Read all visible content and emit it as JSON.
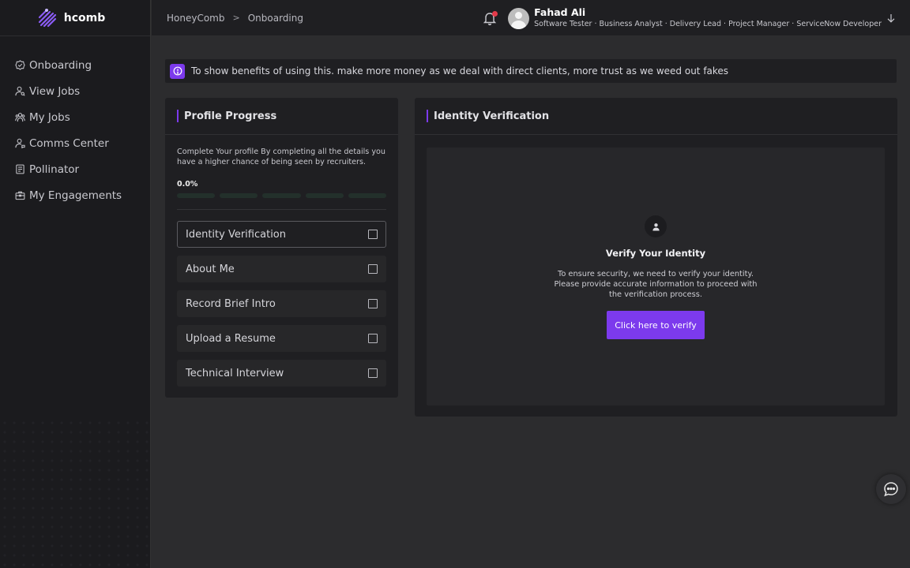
{
  "brand": {
    "name": "hcomb"
  },
  "sidebar": {
    "items": [
      {
        "label": "Onboarding",
        "icon": "badge-check-icon"
      },
      {
        "label": "View Jobs",
        "icon": "user-search-icon"
      },
      {
        "label": "My Jobs",
        "icon": "users-icon"
      },
      {
        "label": "Comms Center",
        "icon": "user-chat-icon"
      },
      {
        "label": "Pollinator",
        "icon": "document-icon"
      },
      {
        "label": "My Engagements",
        "icon": "briefcase-icon"
      }
    ]
  },
  "breadcrumb": {
    "root": "HoneyComb",
    "separator": ">",
    "current": "Onboarding"
  },
  "user": {
    "name": "Fahad Ali",
    "roles": "Software Tester · Business Analyst · Delivery Lead · Project Manager · ServiceNow Developer"
  },
  "banner": {
    "text": "To show benefits of using this. make more money as we deal with direct clients, more trust as we weed out fakes"
  },
  "profile_progress": {
    "title": "Profile Progress",
    "description": "Complete Your profile By completing all the details you have a higher chance of being seen by recruiters.",
    "percent_label": "0.0%",
    "percent": 0,
    "steps": [
      {
        "label": "Identity Verification",
        "checked": false,
        "active": true
      },
      {
        "label": "About Me",
        "checked": false,
        "active": false
      },
      {
        "label": "Record Brief Intro",
        "checked": false,
        "active": false
      },
      {
        "label": "Upload a Resume",
        "checked": false,
        "active": false
      },
      {
        "label": "Technical Interview",
        "checked": false,
        "active": false
      }
    ]
  },
  "identity_verification": {
    "title": "Identity Verification",
    "heading": "Verify Your Identity",
    "text": "To ensure security, we need to verify your identity. Please provide accurate information to proceed with the verification process.",
    "button_label": "Click here to verify"
  },
  "colors": {
    "accent": "#7c3aed",
    "notification": "#e43a4a",
    "background": "#2c2c2e",
    "panel": "#1f1f22"
  }
}
